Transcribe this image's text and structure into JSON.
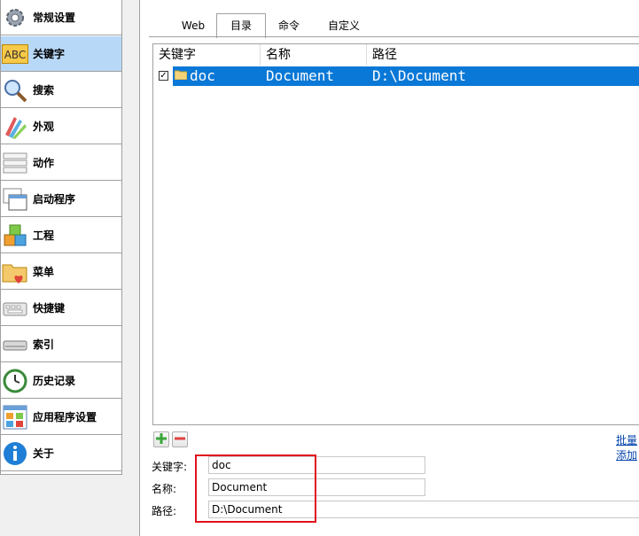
{
  "sidebar": {
    "items": [
      {
        "label": "常规设置",
        "icon": "gear-icon"
      },
      {
        "label": "关键字",
        "icon": "abc-icon",
        "selected": true
      },
      {
        "label": "搜索",
        "icon": "magnifier-icon"
      },
      {
        "label": "外观",
        "icon": "palette-icon"
      },
      {
        "label": "动作",
        "icon": "action-list-icon"
      },
      {
        "label": "启动程序",
        "icon": "windows-icon"
      },
      {
        "label": "工程",
        "icon": "cubes-icon"
      },
      {
        "label": "菜单",
        "icon": "folder-heart-icon"
      },
      {
        "label": "快捷键",
        "icon": "keyboard-icon"
      },
      {
        "label": "索引",
        "icon": "drive-icon"
      },
      {
        "label": "历史记录",
        "icon": "history-clock-icon"
      },
      {
        "label": "应用程序设置",
        "icon": "app-grid-icon"
      },
      {
        "label": "关于",
        "icon": "info-icon"
      }
    ],
    "abc_icon_text": "ABC"
  },
  "tabs": [
    "Web",
    "目录",
    "命令",
    "自定义"
  ],
  "active_tab": "目录",
  "table": {
    "columns": [
      "关键字",
      "名称",
      "路径"
    ],
    "rows": [
      {
        "checked": true,
        "keyword": "doc",
        "name": "Document",
        "path": "D:\\Document"
      }
    ]
  },
  "toolbar": {
    "add_icon": "plus-icon",
    "remove_icon": "minus-icon",
    "batch_link": "批量添加"
  },
  "form": {
    "keyword_label": "关键字:",
    "keyword_value": "doc",
    "name_label": "名称:",
    "name_value": "Document",
    "path_label": "路径:",
    "path_value": "D:\\Document"
  },
  "colors": {
    "selection": "#0a78d7",
    "sidebar_selected": "#b8d8f8",
    "highlight_box": "#e0121c",
    "link": "#0645ad"
  }
}
